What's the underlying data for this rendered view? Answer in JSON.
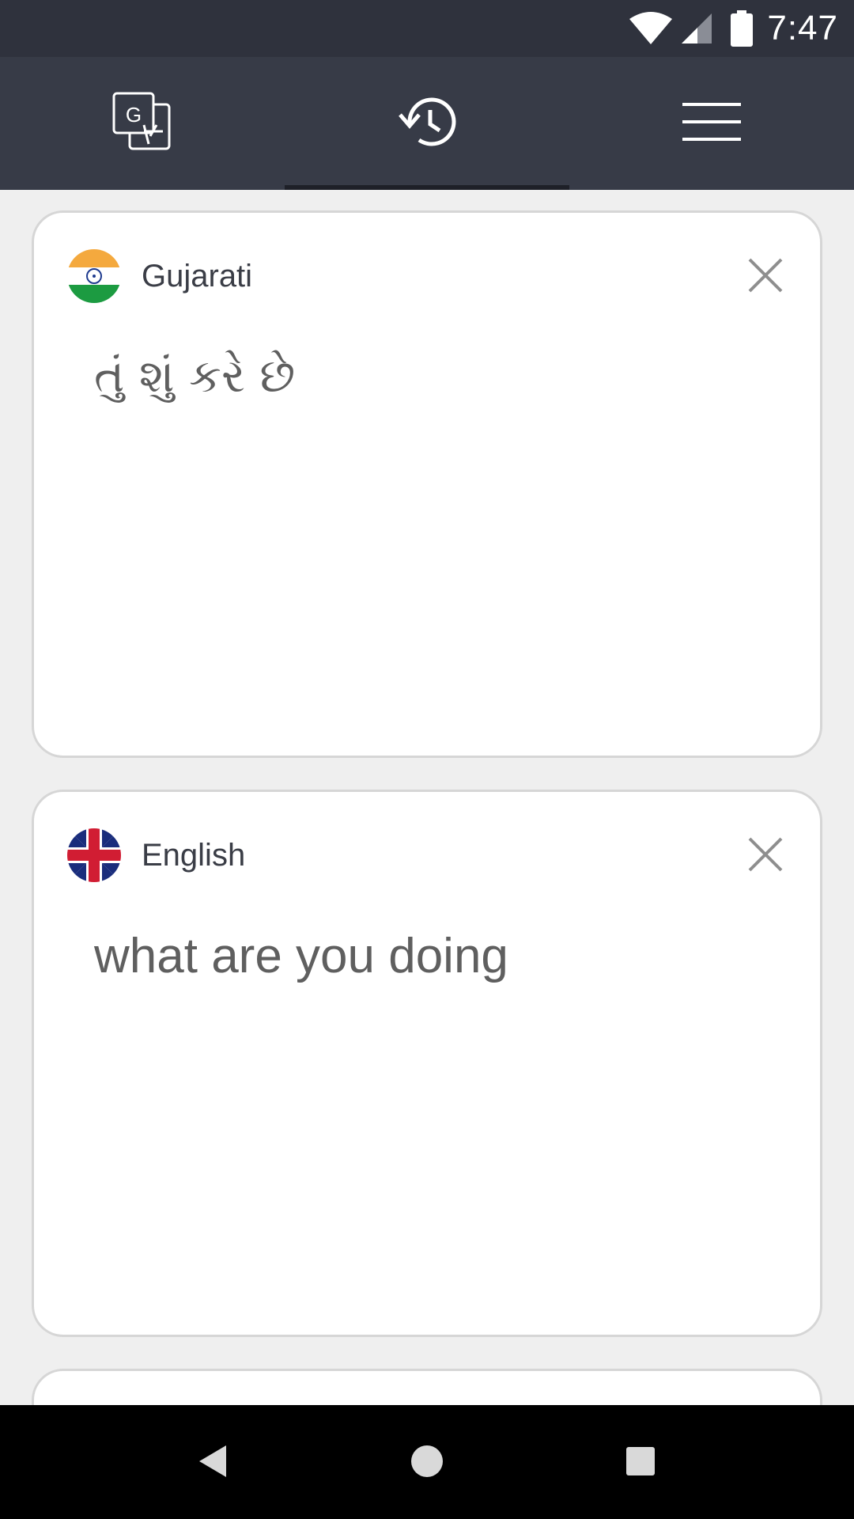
{
  "status_bar": {
    "time": "7:47",
    "icons": [
      "wifi-icon",
      "signal-icon",
      "battery-icon"
    ]
  },
  "top_nav": {
    "tabs": [
      {
        "name": "translate",
        "icon": "translate-icon",
        "active": false
      },
      {
        "name": "history",
        "icon": "history-icon",
        "active": true
      },
      {
        "name": "menu",
        "icon": "menu-icon",
        "active": false
      }
    ]
  },
  "cards": [
    {
      "language": "Gujarati",
      "flag": "india-flag-icon",
      "text": "તું શું કરે છે"
    },
    {
      "language": "English",
      "flag": "uk-flag-icon",
      "text": "what are you doing"
    }
  ],
  "system_nav": {
    "buttons": [
      "back-icon",
      "home-icon",
      "recents-icon"
    ]
  },
  "colors": {
    "status_bar": "#2f323d",
    "top_nav": "#373b47",
    "background": "#efefef",
    "card": "#ffffff",
    "text": "#5f5f5f"
  }
}
